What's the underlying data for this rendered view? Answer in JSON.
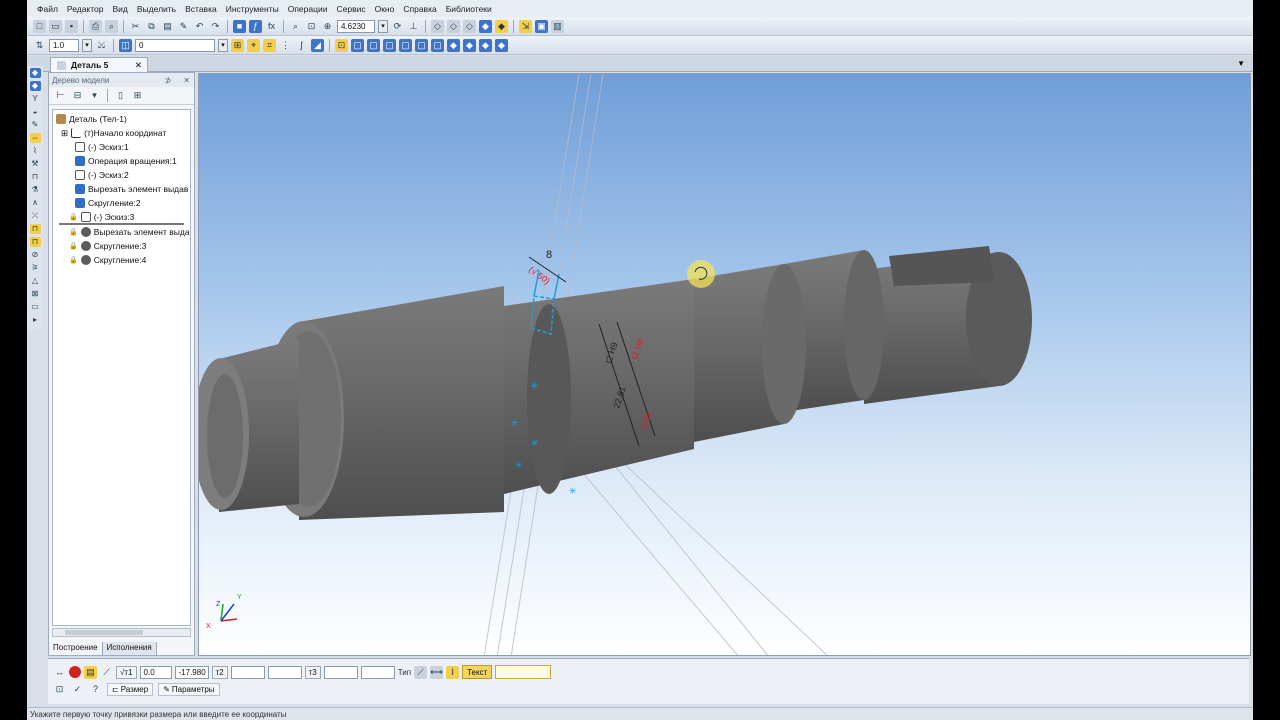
{
  "menu": [
    "Файл",
    "Редактор",
    "Вид",
    "Выделить",
    "Вставка",
    "Инструменты",
    "Операции",
    "Сервис",
    "Окно",
    "Справка",
    "Библиотеки"
  ],
  "toolbar": {
    "zoom_value": "4.6230",
    "line_scale": "1.0",
    "layer_value": "0"
  },
  "document_tab": {
    "label": "Деталь 5",
    "close": "✕"
  },
  "tree": {
    "title": "Дерево модели",
    "pin": "⊅",
    "close": "✕",
    "items": [
      {
        "label": "Деталь (Тел-1)",
        "icon": "part-icon",
        "locked": false
      },
      {
        "label": "(т)Начало координат",
        "icon": "origin-icon",
        "locked": false
      },
      {
        "label": "(-) Эскиз:1",
        "icon": "sketch-icon",
        "locked": false
      },
      {
        "label": "Операция вращения:1",
        "icon": "revolve-icon",
        "locked": false
      },
      {
        "label": "(-) Эскиз:2",
        "icon": "sketch-icon",
        "locked": false
      },
      {
        "label": "Вырезать элемент выдав",
        "icon": "cut-extrude-icon",
        "locked": false
      },
      {
        "label": "Скругление:2",
        "icon": "fillet-icon",
        "locked": false
      },
      {
        "label": "(-) Эскиз:3",
        "icon": "sketch-icon",
        "locked": true
      },
      {
        "label": "Вырезать элемент выда",
        "icon": "cut-extrude-icon",
        "locked": true
      },
      {
        "label": "Скругление:3",
        "icon": "fillet-icon",
        "locked": true
      },
      {
        "label": "Скругление:4",
        "icon": "fillet-icon",
        "locked": true
      }
    ],
    "tabs": [
      "Построение",
      "Исполнения"
    ]
  },
  "viewport": {
    "dimension_labels": [
      "8",
      "t2 H9",
      "t2 H8",
      "22,81"
    ],
    "triad": {
      "x": "X",
      "y": "Y",
      "z": "Z"
    },
    "colors": {
      "shaft": "#6f6f6f",
      "shaft_dark": "#4b4b4b",
      "sketch": "#1fa0d6",
      "dimension_red": "#e02020",
      "cursor_highlight": "#f3e15a"
    }
  },
  "props": {
    "p1_label": "т1",
    "p1_x": "0.0",
    "p1_y": "-17.980",
    "p2_label": "т2",
    "p3_label": "т3",
    "type_label": "Тип",
    "text_label": "Текст",
    "tab_dimension": "Размер",
    "tab_parameters": "Параметры"
  },
  "status_text": "Укажите первую точку привязки размера или введите ее координаты"
}
